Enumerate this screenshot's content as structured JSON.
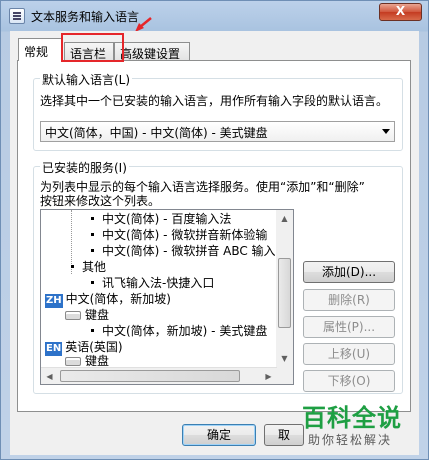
{
  "window": {
    "title": "文本服务和输入语言",
    "close_label": "X"
  },
  "tabs": [
    {
      "label": "常规",
      "active": true
    },
    {
      "label": "语言栏",
      "active": false
    },
    {
      "label": "高级键设置",
      "active": false
    }
  ],
  "default_language": {
    "legend": "默认输入语言(L)",
    "description": "选择其中一个已安装的输入语言，用作所有输入字段的默认语言。",
    "selected": "中文(简体，中国) - 中文(简体) - 美式键盘"
  },
  "installed_services": {
    "legend": "已安装的服务(I)",
    "description_line1": "为列表中显示的每个输入语言选择服务。使用“添加”和“删除”",
    "description_line2": "按钮来修改这个列表。",
    "tree": [
      {
        "text": "中文(简体) - 百度输入法",
        "type": "item"
      },
      {
        "text": "中文(简体) - 微软拼音新体验输",
        "type": "item"
      },
      {
        "text": "中文(简体) - 微软拼音 ABC 输入",
        "type": "item"
      },
      {
        "text": "其他",
        "type": "group"
      },
      {
        "text": "讯飞输入法-快捷入口",
        "type": "item"
      },
      {
        "badge": "ZH",
        "text": "中文(简体，新加坡)",
        "type": "language"
      },
      {
        "text": "键盘",
        "type": "keyboard"
      },
      {
        "text": "中文(简体，新加坡) - 美式键盘",
        "type": "item"
      },
      {
        "badge": "EN",
        "text": "英语(英国)",
        "type": "language"
      },
      {
        "text": "键盘",
        "type": "keyboard"
      }
    ],
    "buttons": {
      "add": "添加(D)...",
      "remove": "删除(R)",
      "properties": "属性(P)...",
      "move_up": "上移(U)",
      "move_down": "下移(O)"
    }
  },
  "footer": {
    "ok": "确定",
    "cancel": "取"
  },
  "watermark": {
    "title": "百科全说",
    "subtitle": "助你轻松解决"
  },
  "colors": {
    "highlight_box": "#e5262a",
    "watermark_green": "#1e9f43",
    "language_badge": "#2d72c9"
  }
}
